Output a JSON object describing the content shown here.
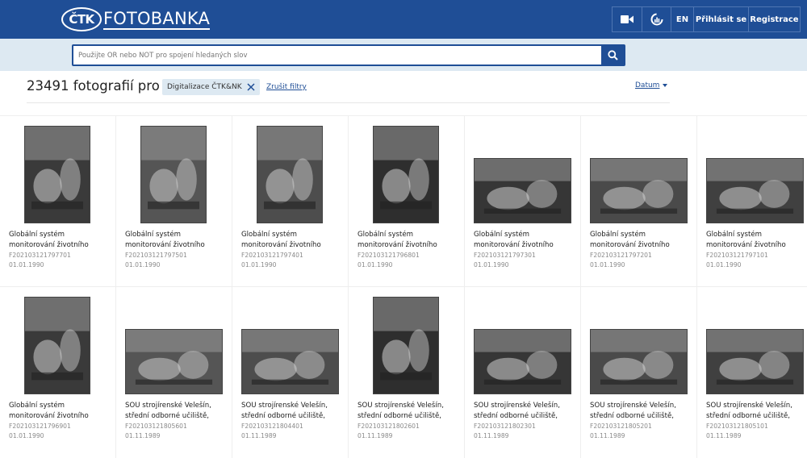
{
  "header": {
    "logo_mark": "ČTK",
    "logo_text": "FOTOBANKA",
    "nav": {
      "video_icon": "video-camera-icon",
      "analytics_icon": "analytics-icon",
      "language": "EN",
      "login": "Přihlásit se",
      "register": "Registrace"
    },
    "brand_color": "#1f4e96"
  },
  "search": {
    "placeholder": "Použijte OR nebo NOT pro spojení hledaných slov",
    "button_icon": "search-icon"
  },
  "results": {
    "title": "23491 fotografií pro",
    "filter_chip": "Digitalizace ČTK&NK",
    "clear_filters": "Zrušit filtry",
    "sort_label": "Datum"
  },
  "photos": [
    {
      "caption": "Globální systém monitorování životního",
      "id": "F202103121797701",
      "date": "01.01.1990",
      "orientation": "portrait"
    },
    {
      "caption": "Globální systém monitorování životního",
      "id": "F202103121797501",
      "date": "01.01.1990",
      "orientation": "portrait"
    },
    {
      "caption": "Globální systém monitorování životního",
      "id": "F202103121797401",
      "date": "01.01.1990",
      "orientation": "portrait"
    },
    {
      "caption": "Globální systém monitorování životního",
      "id": "F202103121796801",
      "date": "01.01.1990",
      "orientation": "portrait"
    },
    {
      "caption": "Globální systém monitorování životního",
      "id": "F202103121797301",
      "date": "01.01.1990",
      "orientation": "landscape"
    },
    {
      "caption": "Globální systém monitorování životního",
      "id": "F202103121797201",
      "date": "01.01.1990",
      "orientation": "landscape"
    },
    {
      "caption": "Globální systém monitorování životního",
      "id": "F202103121797101",
      "date": "01.01.1990",
      "orientation": "landscape"
    },
    {
      "caption": "Globální systém monitorování životního",
      "id": "F202103121796901",
      "date": "01.01.1990",
      "orientation": "portrait"
    },
    {
      "caption": "SOU strojírenské Velešín, střední odborné učiliště,",
      "id": "F202103121805601",
      "date": "01.11.1989",
      "orientation": "landscape"
    },
    {
      "caption": "SOU strojírenské Velešín, střední odborné učiliště,",
      "id": "F202103121804401",
      "date": "01.11.1989",
      "orientation": "landscape"
    },
    {
      "caption": "SOU strojírenské Velešín, střední odborné učiliště,",
      "id": "F202103121802601",
      "date": "01.11.1989",
      "orientation": "portrait"
    },
    {
      "caption": "SOU strojírenské Velešín, střední odborné učiliště,",
      "id": "F202103121802301",
      "date": "01.11.1989",
      "orientation": "landscape"
    },
    {
      "caption": "SOU strojírenské Velešín, střední odborné učiliště,",
      "id": "F202103121805201",
      "date": "01.11.1989",
      "orientation": "landscape"
    },
    {
      "caption": "SOU strojírenské Velešín, střední odborné učiliště,",
      "id": "F202103121805101",
      "date": "01.11.1989",
      "orientation": "landscape"
    }
  ]
}
